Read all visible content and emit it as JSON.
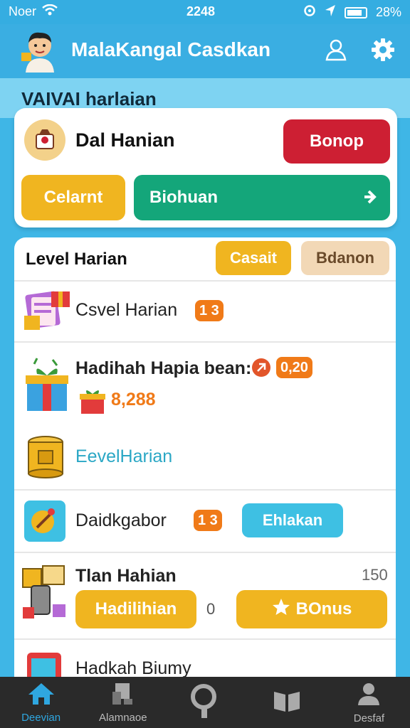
{
  "status_bar": {
    "carrier": "Noer",
    "time": "2248",
    "battery": "28%"
  },
  "header": {
    "title": "MalaKangal Casdkan"
  },
  "banner": {
    "title": "VAIVAI harlaian"
  },
  "daily": {
    "title": "Dal Hanian",
    "red_button": "Bonop",
    "yellow_button": "Celarnt",
    "green_button": "Biohuan"
  },
  "list": {
    "header_title": "Level Harian",
    "header_btn_orange": "Casait",
    "header_btn_tan": "Bdanon",
    "row1": {
      "text": "Csvel Harian",
      "badge": "1 3"
    },
    "row2": {
      "text": "Hadihah Hapia bean:",
      "badge": "0,20",
      "amount": "8,288"
    },
    "row3": {
      "text": "EevelHarian"
    },
    "row4": {
      "text": "Daidkgabor",
      "badge": "1 3",
      "button": "Ehlakan"
    },
    "row5": {
      "text": "Tlan Hahian",
      "count": "150",
      "button_yellow": "Hadilihian",
      "zero": "0",
      "button_bonus": "BOnus"
    },
    "row6": {
      "text": "Hadkah Biumy"
    }
  },
  "bottom_nav": [
    {
      "label": "Deevian",
      "icon": "home-icon"
    },
    {
      "label": "Alamnaoe",
      "icon": "chart-icon"
    },
    {
      "label": "",
      "icon": "search-icon"
    },
    {
      "label": "",
      "icon": "book-icon"
    },
    {
      "label": "Desfaf",
      "icon": "person-icon"
    }
  ],
  "colors": {
    "sky": "#3fb6e6",
    "red": "#cd1f33",
    "yellow": "#f0b520",
    "green": "#14a67a",
    "orange": "#f07a18",
    "teal": "#2aa7c5"
  }
}
